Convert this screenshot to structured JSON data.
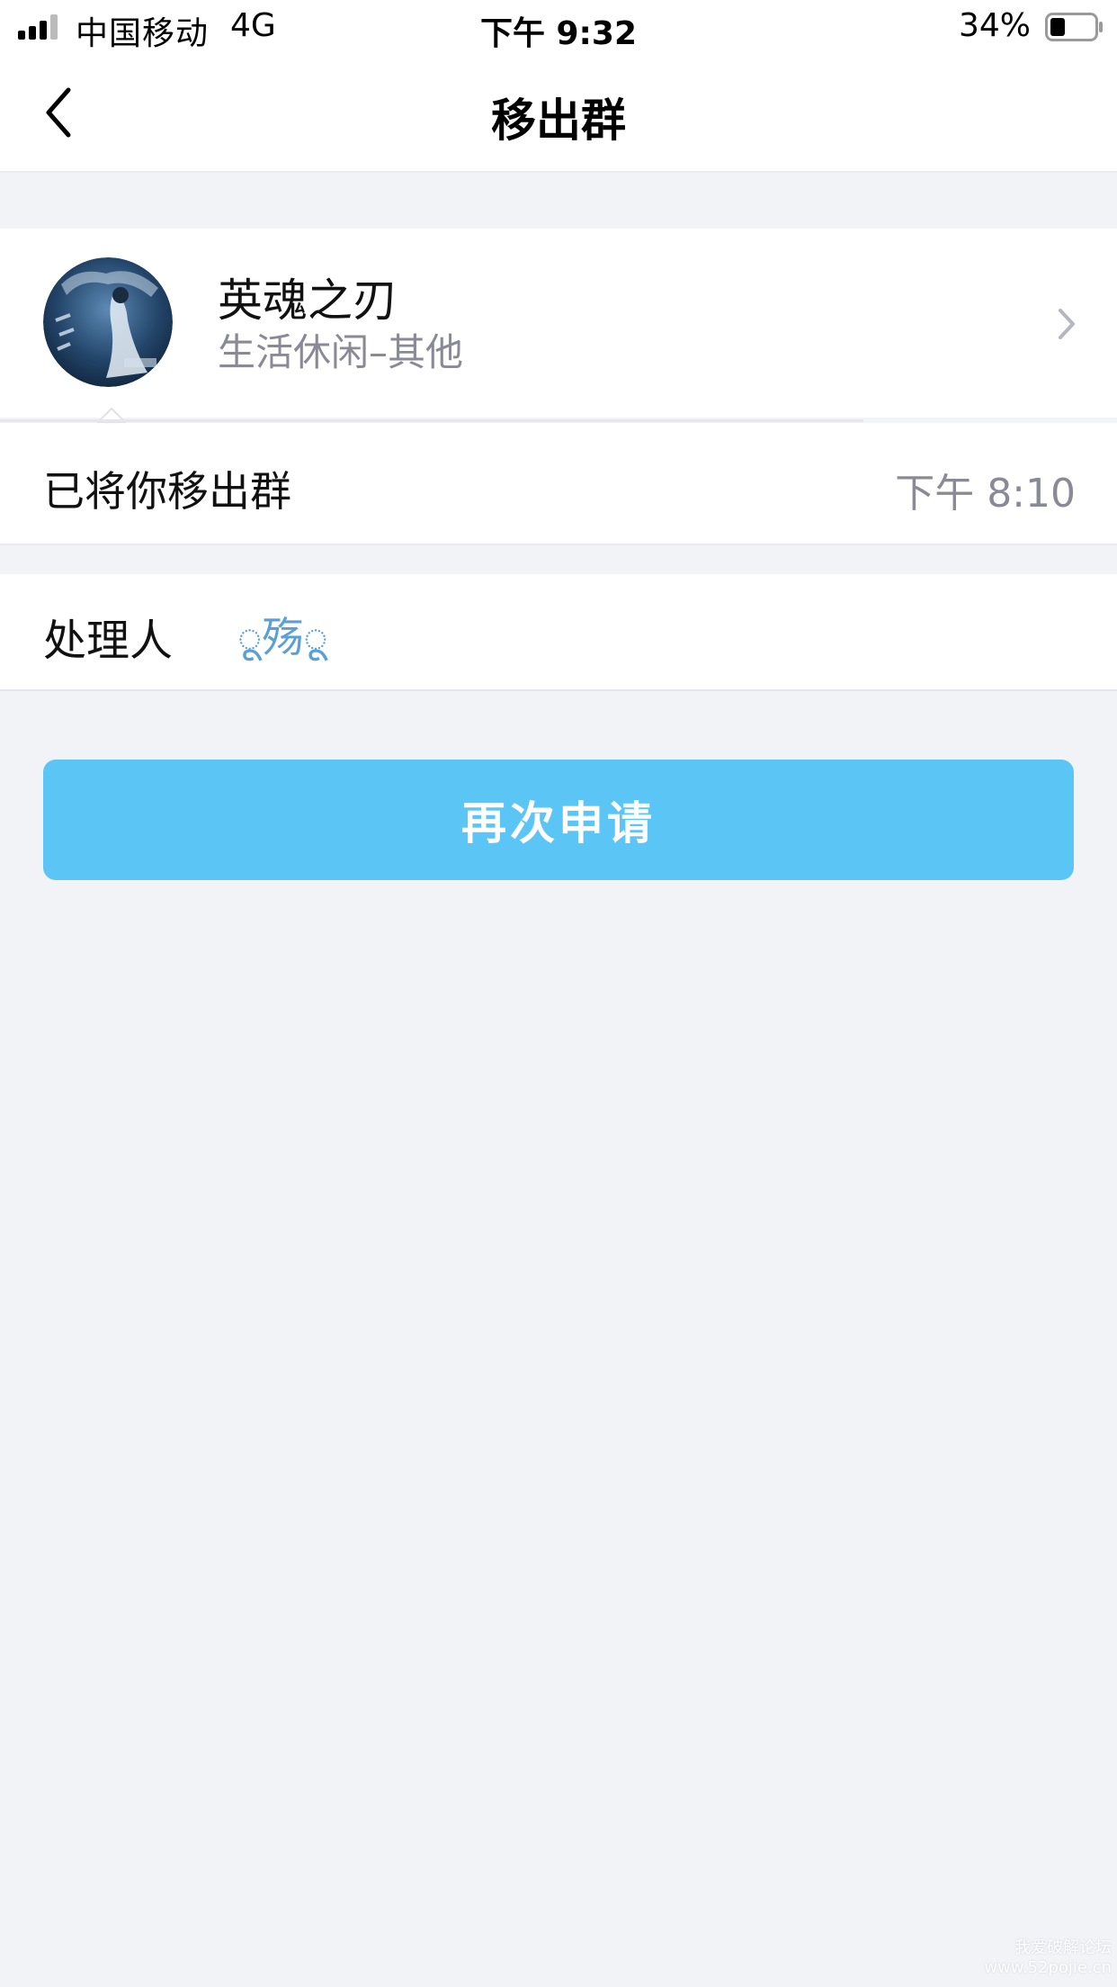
{
  "status_bar": {
    "carrier": "中国移动",
    "network": "4G",
    "time": "下午 9:32",
    "battery_percent": "34%",
    "battery_level": 0.34
  },
  "nav": {
    "title": "移出群",
    "back_icon": "chevron-left-icon"
  },
  "group": {
    "name": "英魂之刃",
    "category": "生活休闲–其他",
    "avatar_icon": "group-avatar",
    "avatar_colors": [
      "#0f2a44",
      "#3f6d98",
      "#c8d8e8"
    ]
  },
  "notice": {
    "text": "已将你移出群",
    "time": "下午 8:10"
  },
  "handler": {
    "label": "处理人",
    "name": "ू殇ू"
  },
  "actions": {
    "reapply_label": "再次申请",
    "accent_color": "#5bc6f5"
  },
  "watermark": {
    "line1": "我爱破解论坛",
    "line2": "www.52pojie.cn"
  }
}
